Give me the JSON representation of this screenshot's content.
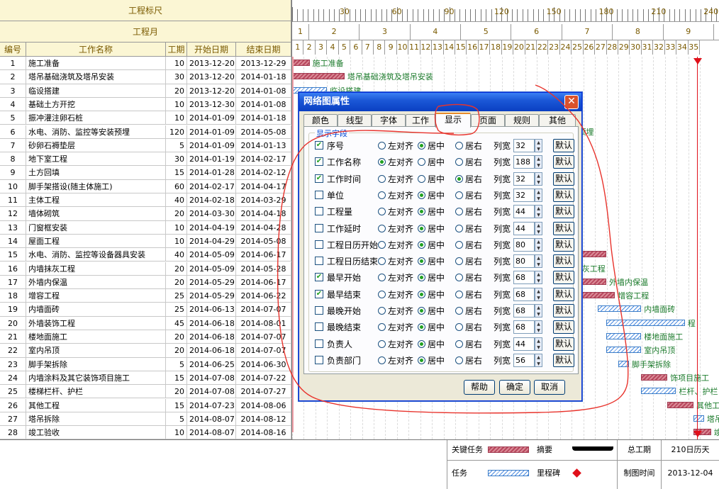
{
  "header": {
    "scale_title": "工程标尺",
    "month_title": "工程月",
    "cols": [
      "编号",
      "工作名称",
      "工期",
      "开始日期",
      "结束日期"
    ]
  },
  "scale_labels": [
    "30",
    "60",
    "90",
    "120",
    "150",
    "180",
    "210",
    "240"
  ],
  "months": [
    "1",
    "2",
    "3",
    "4",
    "5",
    "6",
    "7",
    "8",
    "9"
  ],
  "weeks": [
    "1",
    "2",
    "3",
    "4",
    "5",
    "6",
    "7",
    "8",
    "9",
    "10",
    "11",
    "12",
    "13",
    "14",
    "15",
    "16",
    "17",
    "18",
    "19",
    "20",
    "21",
    "22",
    "23",
    "24",
    "25",
    "26",
    "27",
    "28",
    "29",
    "30",
    "31",
    "32",
    "33",
    "34",
    "35"
  ],
  "tasks": [
    {
      "id": "1",
      "name": "施工准备",
      "dur": "10",
      "start": "2013-12-20",
      "end": "2013-12-29",
      "bar_label": "施工准备"
    },
    {
      "id": "2",
      "name": "塔吊基础浇筑及塔吊安装",
      "dur": "30",
      "start": "2013-12-20",
      "end": "2014-01-18",
      "bar_label": "塔吊基础浇筑及塔吊安装"
    },
    {
      "id": "3",
      "name": "临设搭建",
      "dur": "20",
      "start": "2013-12-20",
      "end": "2014-01-08",
      "bar_label": "临设搭建"
    },
    {
      "id": "4",
      "name": "基础土方开挖",
      "dur": "10",
      "start": "2013-12-30",
      "end": "2014-01-08",
      "bar_label": ""
    },
    {
      "id": "5",
      "name": "振冲灌注卵石桩",
      "dur": "10",
      "start": "2014-01-09",
      "end": "2014-01-18",
      "bar_label": ""
    },
    {
      "id": "6",
      "name": "水电、消防、监控等安装预埋",
      "dur": "120",
      "start": "2014-01-09",
      "end": "2014-05-08",
      "bar_label": "监控等安装预埋"
    },
    {
      "id": "7",
      "name": "砂卵石褥垫层",
      "dur": "5",
      "start": "2014-01-09",
      "end": "2014-01-13",
      "bar_label": ""
    },
    {
      "id": "8",
      "name": "地下室工程",
      "dur": "30",
      "start": "2014-01-19",
      "end": "2014-02-17",
      "bar_label": ""
    },
    {
      "id": "9",
      "name": "土方回填",
      "dur": "15",
      "start": "2014-01-28",
      "end": "2014-02-12",
      "bar_label": ""
    },
    {
      "id": "10",
      "name": "脚手架搭设(随主体施工)",
      "dur": "60",
      "start": "2014-02-17",
      "end": "2014-04-17",
      "bar_label": ")"
    },
    {
      "id": "11",
      "name": "主体工程",
      "dur": "40",
      "start": "2014-02-18",
      "end": "2014-03-29",
      "bar_label": ""
    },
    {
      "id": "12",
      "name": "墙体砌筑",
      "dur": "20",
      "start": "2014-03-30",
      "end": "2014-04-18",
      "bar_label": ""
    },
    {
      "id": "13",
      "name": "门窗框安装",
      "dur": "10",
      "start": "2014-04-19",
      "end": "2014-04-28",
      "bar_label": ""
    },
    {
      "id": "14",
      "name": "屋面工程",
      "dur": "10",
      "start": "2014-04-29",
      "end": "2014-05-08",
      "bar_label": ""
    },
    {
      "id": "15",
      "name": "水电、消防、监控等设备器具安装",
      "dur": "40",
      "start": "2014-05-09",
      "end": "2014-06-17",
      "bar_label": ""
    },
    {
      "id": "16",
      "name": "内墙抹灰工程",
      "dur": "20",
      "start": "2014-05-09",
      "end": "2014-05-28",
      "bar_label": "抹灰工程"
    },
    {
      "id": "17",
      "name": "外墙内保温",
      "dur": "20",
      "start": "2014-05-29",
      "end": "2014-06-17",
      "bar_label": "外墙内保温"
    },
    {
      "id": "18",
      "name": "增容工程",
      "dur": "25",
      "start": "2014-05-29",
      "end": "2014-06-22",
      "bar_label": "增容工程"
    },
    {
      "id": "19",
      "name": "内墙面砖",
      "dur": "25",
      "start": "2014-06-13",
      "end": "2014-07-07",
      "bar_label": "内墙面砖"
    },
    {
      "id": "20",
      "name": "外墙装饰工程",
      "dur": "45",
      "start": "2014-06-18",
      "end": "2014-08-01",
      "bar_label": "程"
    },
    {
      "id": "21",
      "name": "楼地面施工",
      "dur": "20",
      "start": "2014-06-18",
      "end": "2014-07-07",
      "bar_label": "楼地面施工"
    },
    {
      "id": "22",
      "name": "室内吊顶",
      "dur": "20",
      "start": "2014-06-18",
      "end": "2014-07-07",
      "bar_label": "室内吊顶"
    },
    {
      "id": "23",
      "name": "脚手架拆除",
      "dur": "5",
      "start": "2014-06-25",
      "end": "2014-06-30",
      "bar_label": "脚手架拆除"
    },
    {
      "id": "24",
      "name": "内墙涂料及其它装饰项目施工",
      "dur": "15",
      "start": "2014-07-08",
      "end": "2014-07-22",
      "bar_label": "饰项目施工"
    },
    {
      "id": "25",
      "name": "楼梯栏杆、护栏",
      "dur": "20",
      "start": "2014-07-08",
      "end": "2014-07-27",
      "bar_label": "栏杆、护栏"
    },
    {
      "id": "26",
      "name": "其他工程",
      "dur": "15",
      "start": "2014-07-23",
      "end": "2014-08-06",
      "bar_label": "其他工程"
    },
    {
      "id": "27",
      "name": "塔吊拆除",
      "dur": "5",
      "start": "2014-08-07",
      "end": "2014-08-12",
      "bar_label": "塔吊拆除"
    },
    {
      "id": "28",
      "name": "竣工验收",
      "dur": "10",
      "start": "2014-08-07",
      "end": "2014-08-16",
      "bar_label": "竣工验收"
    }
  ],
  "legend": {
    "critical": "关键任务",
    "summary": "摘要",
    "task": "任务",
    "milestone": "里程碑",
    "total_label": "总工期",
    "total_value": "210日历天",
    "date_label": "制图时间",
    "date_value": "2013-12-04"
  },
  "dialog": {
    "title": "网络图属性",
    "tabs": [
      "颜色",
      "线型",
      "字体",
      "工作",
      "显示",
      "页面",
      "规则",
      "其他"
    ],
    "active_tab": "显示",
    "group_label": "显示字段",
    "align_left": "左对齐",
    "align_center": "居中",
    "align_right": "居右",
    "width_label": "列宽",
    "default_label": "默认",
    "fields": [
      {
        "name": "序号",
        "checked": "✔",
        "width": "32"
      },
      {
        "name": "工作名称",
        "checked": "✔",
        "width": "188"
      },
      {
        "name": "工作时间",
        "checked": "✔",
        "width": "32"
      },
      {
        "name": "单位",
        "checked": "",
        "width": "32"
      },
      {
        "name": "工程量",
        "checked": "",
        "width": "44"
      },
      {
        "name": "工作延时",
        "checked": "",
        "width": "44"
      },
      {
        "name": "工程日历开始",
        "checked": "",
        "width": "80"
      },
      {
        "name": "工程日历结束",
        "checked": "",
        "width": "80"
      },
      {
        "name": "最早开始",
        "checked": "✔",
        "width": "68"
      },
      {
        "name": "最早结束",
        "checked": "✔",
        "width": "68"
      },
      {
        "name": "最晚开始",
        "checked": "",
        "width": "68"
      },
      {
        "name": "最晚结束",
        "checked": "",
        "width": "68"
      },
      {
        "name": "负责人",
        "checked": "",
        "width": "44"
      },
      {
        "name": "负责部门",
        "checked": "",
        "width": "56"
      }
    ],
    "help": "帮助",
    "ok": "确定",
    "cancel": "取消",
    "close_glyph": "✕",
    "spin_up": "▲",
    "spin_down": "▼"
  }
}
